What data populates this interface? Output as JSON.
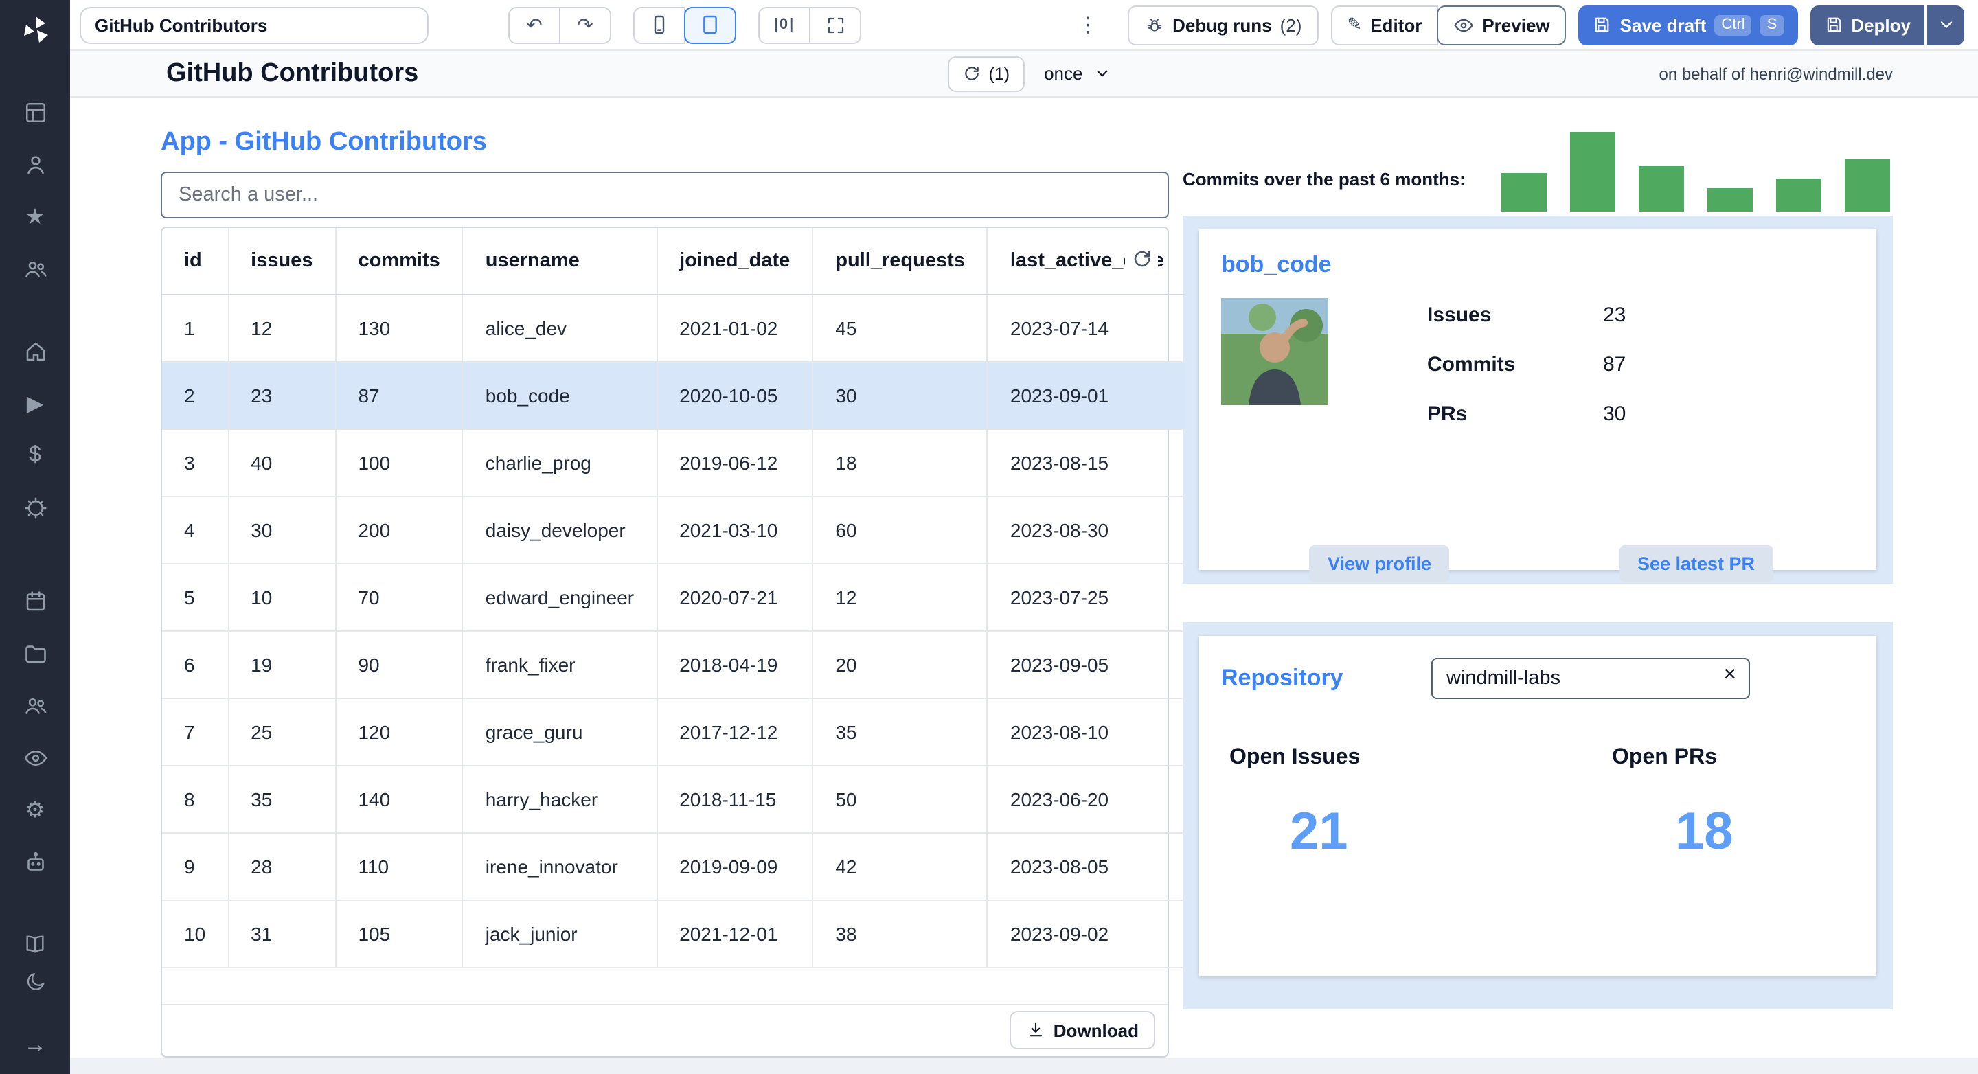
{
  "colors": {
    "accent_blue": "#3b82f6",
    "save_button_blue": "#4374da",
    "deploy_button_blue": "#4a6191",
    "panel_blue": "#dbe8f7",
    "bar_green": "#4fa95f",
    "big_number_blue": "#5d9ef8",
    "selected_row_blue": "#d8e6f9",
    "sidebar_dark": "#232936"
  },
  "icons": {
    "undo": "↶",
    "redo": "↷",
    "kebab": "⋮",
    "close": "×",
    "star": "★",
    "play": "▶",
    "dollar": "$",
    "gear": "⚙",
    "pencil": "✎",
    "arrow_right": "→",
    "zero_panel": "|0|"
  },
  "topbar": {
    "app_name": "GitHub Contributors",
    "debug_runs_label": "Debug runs",
    "debug_runs_count": "(2)",
    "editor_label": "Editor",
    "preview_label": "Preview",
    "save_draft_label": "Save draft",
    "kbd_ctrl": "Ctrl",
    "kbd_s": "S",
    "deploy_label": "Deploy"
  },
  "header": {
    "title": "GitHub Contributors",
    "refresh_count": "(1)",
    "schedule": "once",
    "on_behalf": "on behalf of henri@windmill.dev"
  },
  "app": {
    "title": "App - GitHub Contributors",
    "search_placeholder": "Search a user...",
    "table": {
      "columns": [
        "id",
        "issues",
        "commits",
        "username",
        "joined_date",
        "pull_requests",
        "last_active_date"
      ],
      "rows": [
        [
          "1",
          "12",
          "130",
          "alice_dev",
          "2021-01-02",
          "45",
          "2023-07-14"
        ],
        [
          "2",
          "23",
          "87",
          "bob_code",
          "2020-10-05",
          "30",
          "2023-09-01"
        ],
        [
          "3",
          "40",
          "100",
          "charlie_prog",
          "2019-06-12",
          "18",
          "2023-08-15"
        ],
        [
          "4",
          "30",
          "200",
          "daisy_developer",
          "2021-03-10",
          "60",
          "2023-08-30"
        ],
        [
          "5",
          "10",
          "70",
          "edward_engineer",
          "2020-07-21",
          "12",
          "2023-07-25"
        ],
        [
          "6",
          "19",
          "90",
          "frank_fixer",
          "2018-04-19",
          "20",
          "2023-09-05"
        ],
        [
          "7",
          "25",
          "120",
          "grace_guru",
          "2017-12-12",
          "35",
          "2023-08-10"
        ],
        [
          "8",
          "35",
          "140",
          "harry_hacker",
          "2018-11-15",
          "50",
          "2023-06-20"
        ],
        [
          "9",
          "28",
          "110",
          "irene_innovator",
          "2019-09-09",
          "42",
          "2023-08-05"
        ],
        [
          "10",
          "31",
          "105",
          "jack_junior",
          "2021-12-01",
          "38",
          "2023-09-02"
        ]
      ],
      "selected_row_index": 1,
      "download_label": "Download"
    },
    "commits_chart": {
      "type": "bar",
      "label": "Commits over the past 6 months:",
      "bar_heights": [
        28,
        58,
        33,
        17,
        24,
        38
      ]
    },
    "user_card": {
      "username": "bob_code",
      "stats": [
        {
          "label": "Issues",
          "value": "23"
        },
        {
          "label": "Commits",
          "value": "87"
        },
        {
          "label": "PRs",
          "value": "30"
        }
      ],
      "view_profile_label": "View profile",
      "see_latest_pr_label": "See latest PR"
    },
    "repo_card": {
      "title": "Repository",
      "input_value": "windmill-labs",
      "open_issues_label": "Open Issues",
      "open_issues_value": "21",
      "open_prs_label": "Open PRs",
      "open_prs_value": "18"
    }
  }
}
